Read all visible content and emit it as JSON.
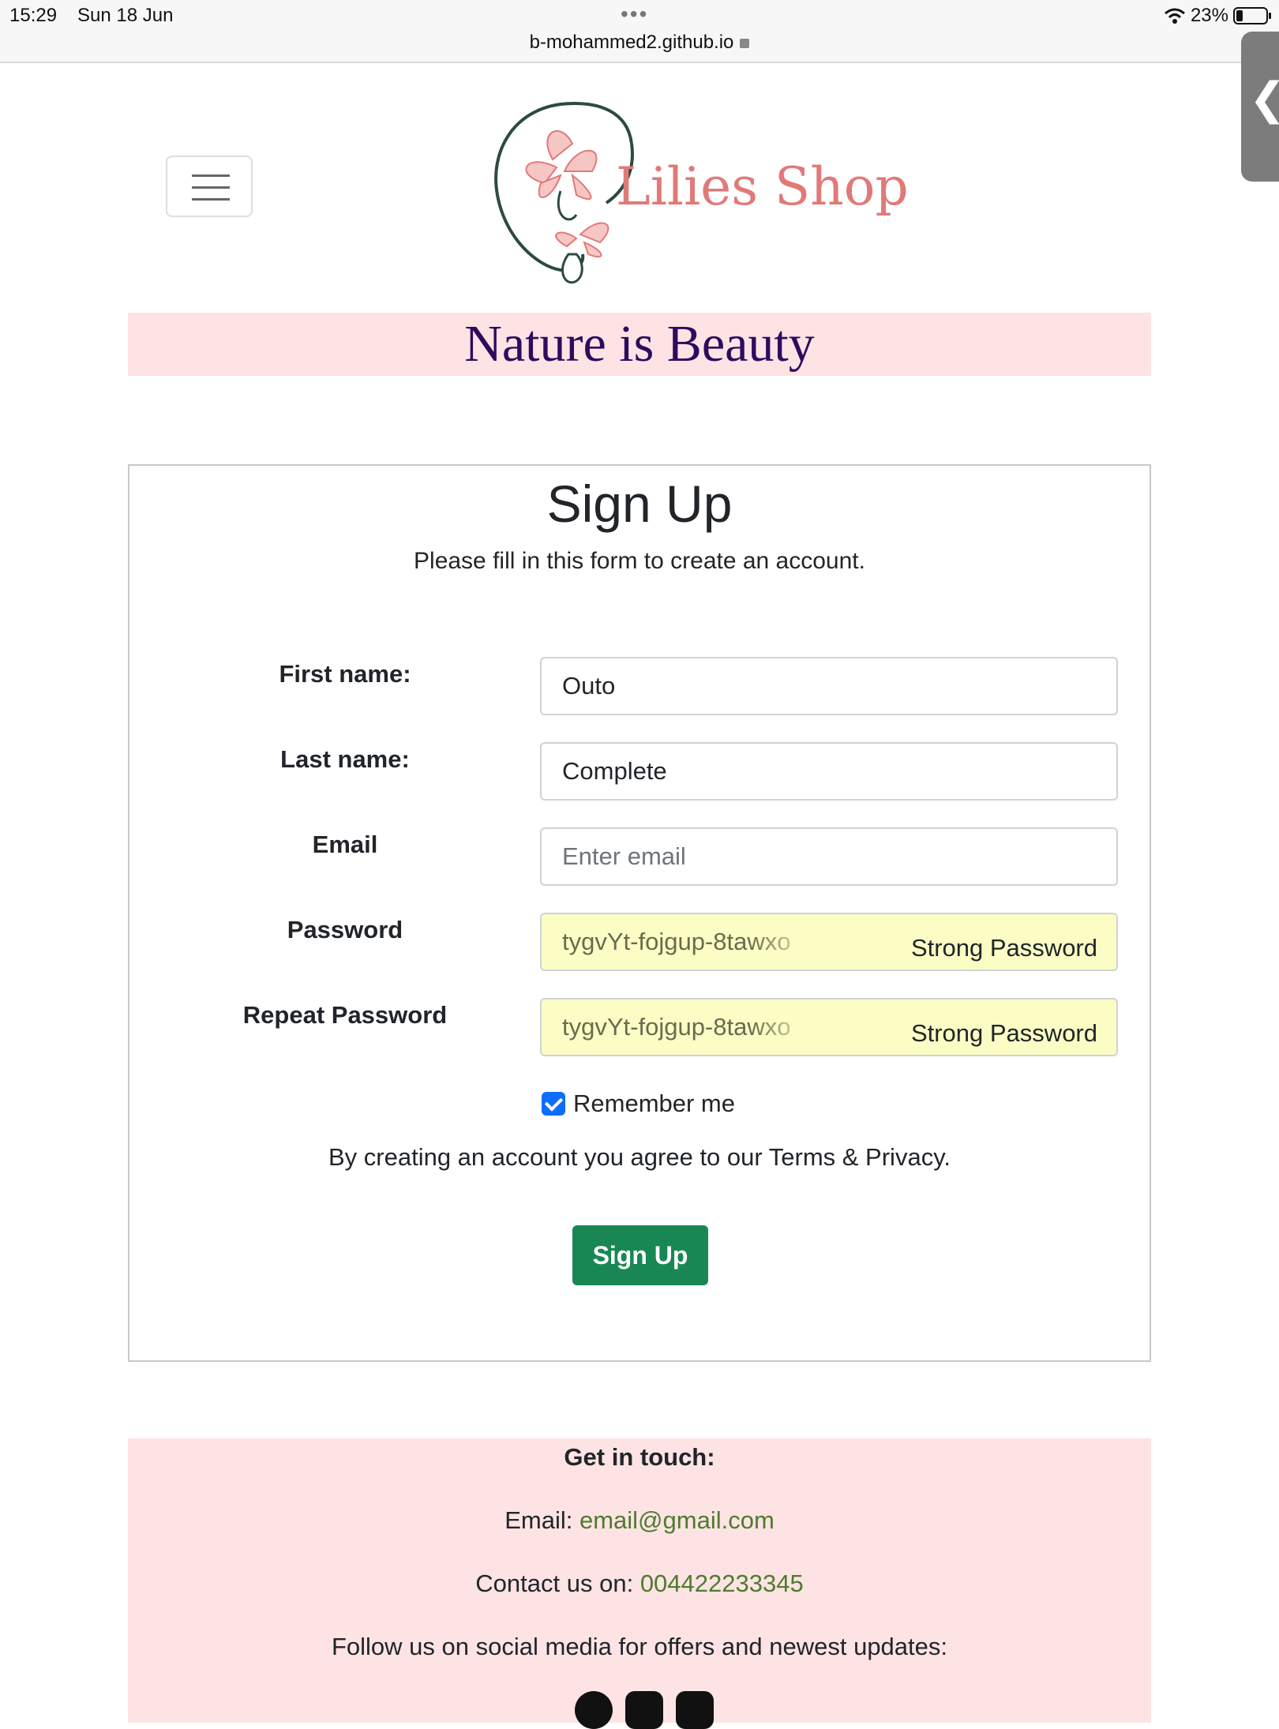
{
  "status_bar": {
    "time": "15:29",
    "date": "Sun 18 Jun",
    "url": "b-mohammed2.github.io",
    "battery": "23%",
    "battery_level": 0.23,
    "icons": [
      "more-dots-icon",
      "lock-icon",
      "wifi-icon",
      "battery-icon"
    ]
  },
  "header": {
    "menu_icon": "hamburger-icon",
    "logo_text": "Lilies Shop",
    "tagline": "Nature is Beauty",
    "colors": {
      "logo_text": "#e07a79",
      "tagline": "#2f0b5e",
      "banner_bg": "#fde3e4"
    }
  },
  "form": {
    "title": "Sign Up",
    "subtitle": "Please fill in this form to create an account.",
    "fields": {
      "first_name": {
        "label": "First name:",
        "value": "Outo"
      },
      "last_name": {
        "label": "Last name:",
        "value": "Complete"
      },
      "email": {
        "label": "Email",
        "placeholder": "Enter email",
        "value": ""
      },
      "password": {
        "label": "Password",
        "value": "tygvYt-fojgup-8tawxo",
        "hint": "Strong Password"
      },
      "repeat_password": {
        "label": "Repeat Password",
        "value": "tygvYt-fojgup-8tawxo",
        "hint": "Strong Password"
      }
    },
    "remember_me": {
      "label": "Remember me",
      "checked": true
    },
    "terms": "By creating an account you agree to our Terms & Privacy.",
    "submit_label": "Sign Up",
    "colors": {
      "submit_bg": "#198754",
      "checkbox": "#0d6efd",
      "autofill_bg": "#fbfdc4"
    }
  },
  "footer": {
    "heading": "Get in touch:",
    "email_label": "Email:",
    "email": "email@gmail.com",
    "contact_label": "Contact us on:",
    "phone": "004422233345",
    "follow_text": "Follow us on social media for offers and newest updates:",
    "social_icons": [
      "facebook-icon",
      "instagram-icon",
      "youtube-icon"
    ],
    "colors": {
      "link": "#4f7b2e",
      "bg": "#fde3e4"
    }
  }
}
